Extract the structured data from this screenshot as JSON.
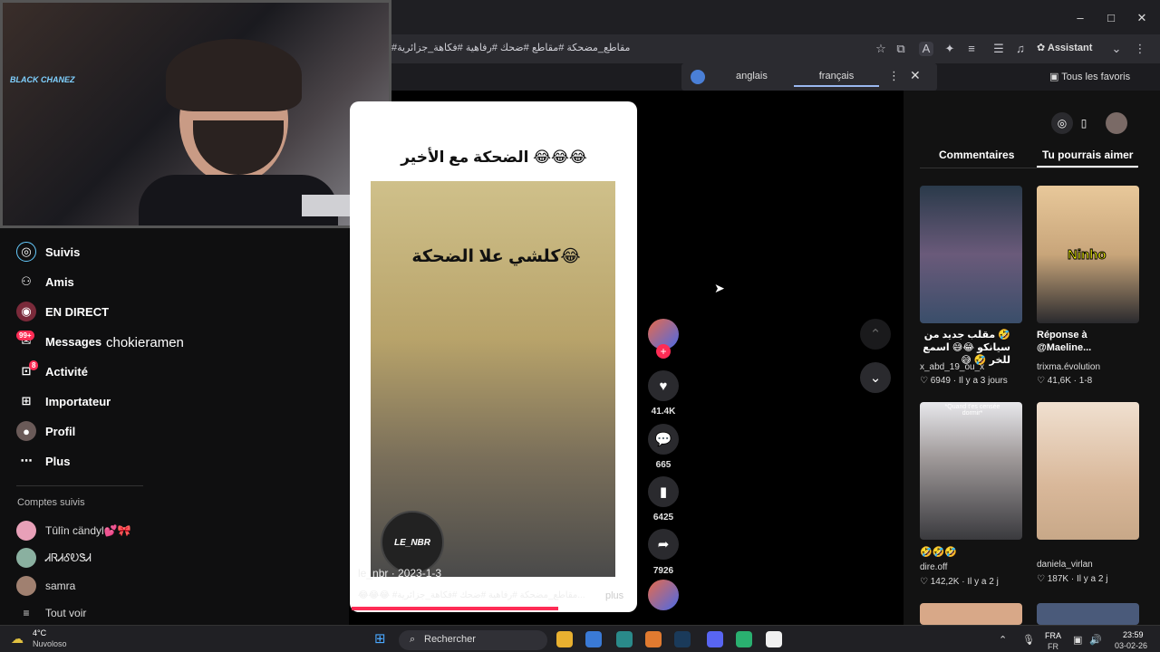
{
  "browser": {
    "url_text": "#مقاطع_مضحكة #مقاطع #ضحك #رفاهية #فكاهة_جزائرية",
    "assistant_label": "Assistant",
    "bookmarks_label": "Tous les favoris",
    "window_controls": [
      "–",
      "□",
      "✕"
    ]
  },
  "translate": {
    "lang_from": "anglais",
    "lang_to": "français"
  },
  "stream": {
    "channel_text": "BLACK CHANEZ",
    "overlay_name": "chokieramen"
  },
  "sidebar": {
    "items": [
      {
        "label": "Suivis",
        "icon": "following-icon"
      },
      {
        "label": "Amis",
        "icon": "friends-icon"
      },
      {
        "label": "EN DIRECT",
        "icon": "live-icon"
      },
      {
        "label": "Messages",
        "icon": "messages-icon",
        "badge": "99+"
      },
      {
        "label": "Activité",
        "icon": "activity-icon",
        "badge": "8"
      },
      {
        "label": "Importateur",
        "icon": "upload-icon"
      },
      {
        "label": "Profil",
        "icon": "profile-icon"
      },
      {
        "label": "Plus",
        "icon": "more-icon"
      }
    ],
    "followed_title": "Comptes suivis",
    "followed": [
      {
        "name": "Tûlîn cändyl💕🎀"
      },
      {
        "name": "ᏗᏒᏗᎴᎧᏕᏗ"
      },
      {
        "name": "samra"
      }
    ],
    "see_all": "Tout voir"
  },
  "video": {
    "caption_top": "الضحكة مع الأخير 😂😂😂",
    "caption_mid": "كلشي علا الضحكة😂",
    "watermark": "LE_NBR",
    "author": "le_nbr",
    "date": "2023-1-3",
    "description": "😂😂😂 #مقاطع_مضحكة #رفاهية #ضحك #فكاهة_جزائرية...",
    "more_label": "plus",
    "likes": "41.4K",
    "comments": "665",
    "saves": "6425",
    "shares": "7926"
  },
  "right_panel": {
    "tabs": [
      "Commentaires",
      "Tu pourrais aimer"
    ],
    "active_tab": 1,
    "cards": [
      {
        "title": "🤣 مقلب جديد من سيانكو 😂😅 اسمع للخر 🤣 😅",
        "author": "x_abd_19_ou_x",
        "likes": "6949",
        "age": "Il y a 3 jours",
        "color": "#3a4e6a"
      },
      {
        "title": "Réponse à @Maeline...",
        "author": "trixma.évolution",
        "likes": "41,6K",
        "age": "1-8",
        "overlay": "Ninho",
        "color": "#c8a57a"
      },
      {
        "title": "🤣🤣🤣",
        "author": "dire.off",
        "likes": "142,2K",
        "age": "Il y a 2 j",
        "overlay": "*Quand t'es censée dormir*",
        "color": "#3a3a3e"
      },
      {
        "title": "",
        "author": "daniela_virlan",
        "likes": "187K",
        "age": "Il y a 2 j",
        "color": "#d9b89a"
      }
    ]
  },
  "taskbar": {
    "weather_temp": "4°C",
    "weather_desc": "Nuvoloso",
    "search_label": "Rechercher",
    "lang": "FRA",
    "lang_sub": "FR",
    "time": "23:59",
    "date": "03-02-26"
  }
}
